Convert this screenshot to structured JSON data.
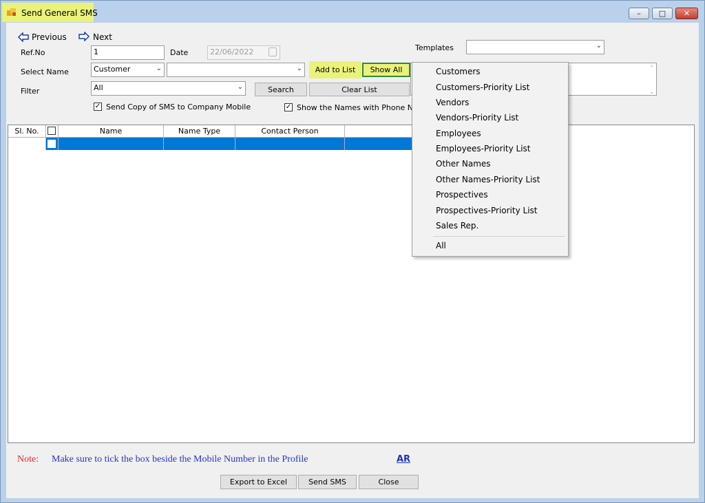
{
  "window": {
    "title": "Send General SMS",
    "controls": {
      "minimize": "–",
      "maximize": "□",
      "close": "✕"
    }
  },
  "nav": {
    "previous": "Previous",
    "next": "Next"
  },
  "form": {
    "refno_label": "Ref.No",
    "refno_value": "1",
    "date_label": "Date",
    "date_value": "22/06/2022",
    "select_name_label": "Select Name",
    "select_name_type": "Customer",
    "select_name_value": "",
    "filter_label": "Filter",
    "filter_value": "All",
    "templates_label": "Templates",
    "templates_value": "",
    "send_copy_label": "Send Copy of SMS to Company Mobile",
    "send_copy_checked": true,
    "show_names_label": "Show the Names with Phone Numb",
    "show_names_checked": true
  },
  "buttons": {
    "add_to_list": "Add to List",
    "show_all": "Show All",
    "search": "Search",
    "clear_list": "Clear List",
    "export_to_excel": "Export to Excel",
    "send_sms": "Send SMS",
    "close": "Close"
  },
  "grid": {
    "columns": [
      "Sl. No.",
      "",
      "Name",
      "Name Type",
      "Contact Person",
      ""
    ]
  },
  "dropdown_menu": {
    "items": [
      "Customers",
      "Customers-Priority List",
      "Vendors",
      "Vendors-Priority List",
      "Employees",
      "Employees-Priority List",
      "Other Names",
      "Other Names-Priority List",
      "Prospectives",
      "Prospectives-Priority List",
      "Sales Rep.",
      "All"
    ]
  },
  "footer": {
    "note_label": "Note:",
    "note_text": "Make sure to tick the box beside the Mobile Number in the Profile",
    "ar_link": "AR"
  },
  "colors": {
    "highlight": "#eaf27a",
    "selection": "#0078d7",
    "note_red": "#e3262d",
    "note_blue": "#2237c9"
  },
  "icons": [
    "app-icon",
    "previous-arrow-icon",
    "next-arrow-icon",
    "calendar-icon",
    "chevron-down-icon",
    "checkbox-icon"
  ]
}
